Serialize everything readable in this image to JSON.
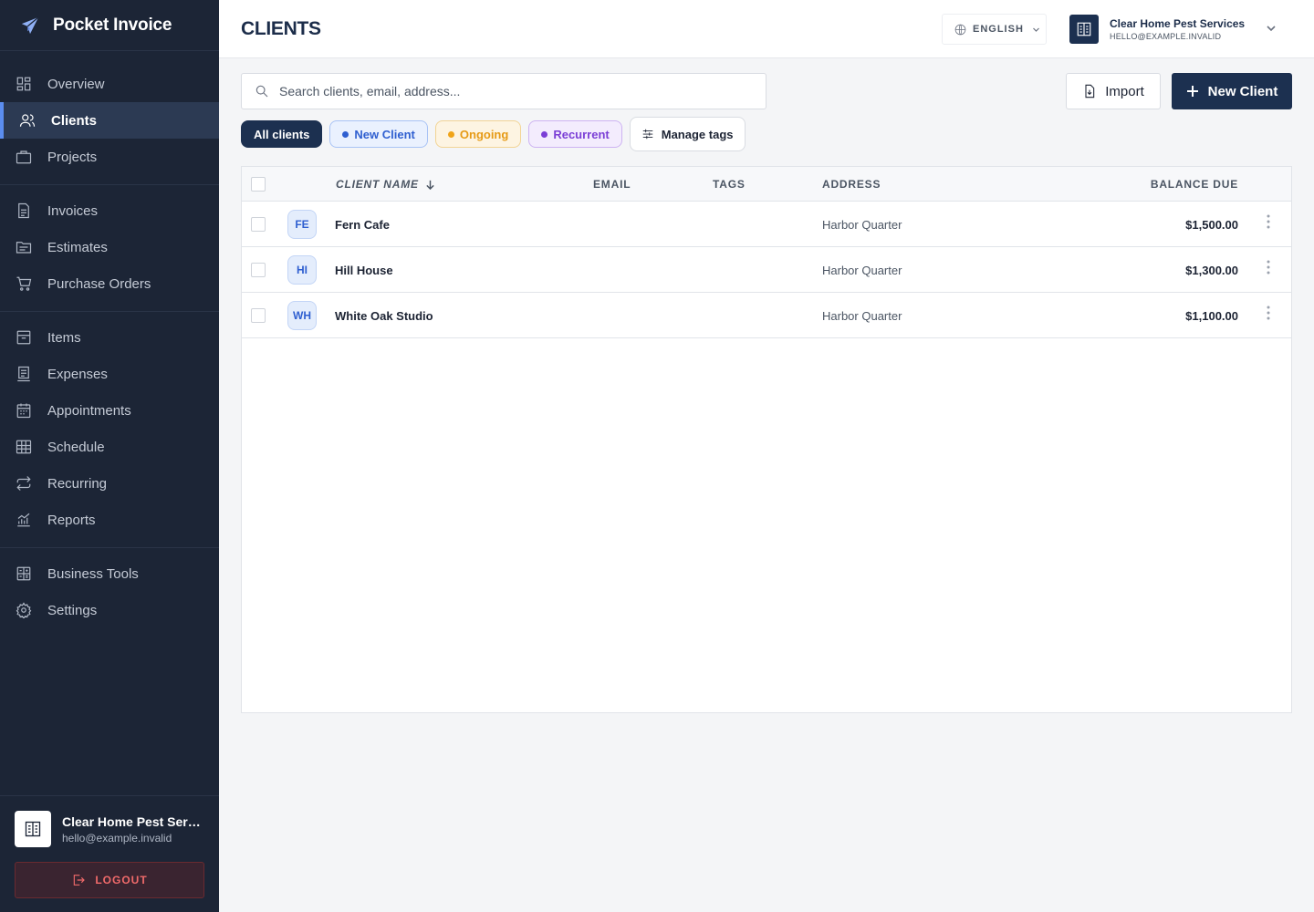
{
  "app": {
    "name": "Pocket Invoice"
  },
  "sidebar": {
    "groups": [
      [
        {
          "label": "Overview",
          "icon": "grid-icon"
        },
        {
          "label": "Clients",
          "icon": "users-icon",
          "active": true
        },
        {
          "label": "Projects",
          "icon": "briefcase-icon"
        }
      ],
      [
        {
          "label": "Invoices",
          "icon": "document-icon"
        },
        {
          "label": "Estimates",
          "icon": "folder-icon"
        },
        {
          "label": "Purchase Orders",
          "icon": "cart-icon"
        }
      ],
      [
        {
          "label": "Items",
          "icon": "box-icon"
        },
        {
          "label": "Expenses",
          "icon": "receipt-icon"
        },
        {
          "label": "Appointments",
          "icon": "calendar-icon"
        },
        {
          "label": "Schedule",
          "icon": "table-icon"
        },
        {
          "label": "Recurring",
          "icon": "repeat-icon"
        },
        {
          "label": "Reports",
          "icon": "chart-icon"
        }
      ],
      [
        {
          "label": "Business Tools",
          "icon": "calculator-icon"
        },
        {
          "label": "Settings",
          "icon": "gear-icon"
        }
      ]
    ],
    "user": {
      "name": "Clear Home Pest Services",
      "email": "hello@example.invalid"
    },
    "logout_label": "LOGOUT"
  },
  "header": {
    "title": "CLIENTS",
    "language": "ENGLISH",
    "company_name": "Clear Home Pest Services",
    "company_email": "HELLO@EXAMPLE.INVALID"
  },
  "toolbar": {
    "search_placeholder": "Search clients, email, address...",
    "import_label": "Import",
    "new_client_label": "New Client"
  },
  "filters": {
    "all": "All clients",
    "new": "New Client",
    "ongoing": "Ongoing",
    "recurrent": "Recurrent",
    "manage": "Manage tags"
  },
  "table": {
    "columns": {
      "name": "CLIENT NAME",
      "email": "EMAIL",
      "tags": "TAGS",
      "address": "ADDRESS",
      "balance": "BALANCE DUE"
    },
    "rows": [
      {
        "initials": "FE",
        "name": "Fern Cafe",
        "email": "",
        "tags": "",
        "address": "Harbor Quarter",
        "balance": "$1,500.00"
      },
      {
        "initials": "HI",
        "name": "Hill House",
        "email": "",
        "tags": "",
        "address": "Harbor Quarter",
        "balance": "$1,300.00"
      },
      {
        "initials": "WH",
        "name": "White Oak Studio",
        "email": "",
        "tags": "",
        "address": "Harbor Quarter",
        "balance": "$1,100.00"
      }
    ]
  },
  "colors": {
    "sidebar_bg": "#1c2536",
    "primary": "#1c3050",
    "accent": "#5b8def",
    "danger": "#f06a6a"
  }
}
